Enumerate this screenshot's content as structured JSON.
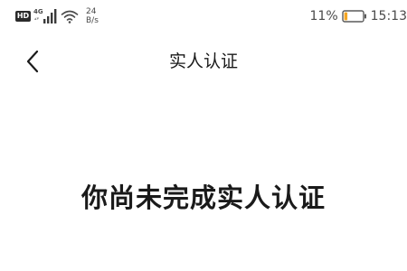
{
  "status_bar": {
    "hd_badge": "HD",
    "network_type": "4G",
    "network_speed_value": "24",
    "network_speed_unit": "B/s",
    "battery_percent": "11%",
    "time": "15:13",
    "icons": [
      "hd-badge",
      "cellular-signal-icon",
      "wifi-icon",
      "battery-low-icon"
    ],
    "battery_color": "#f5a623"
  },
  "header": {
    "back_icon": "chevron-left-icon",
    "title": "实人认证"
  },
  "main": {
    "message": "你尚未完成实人认证"
  }
}
